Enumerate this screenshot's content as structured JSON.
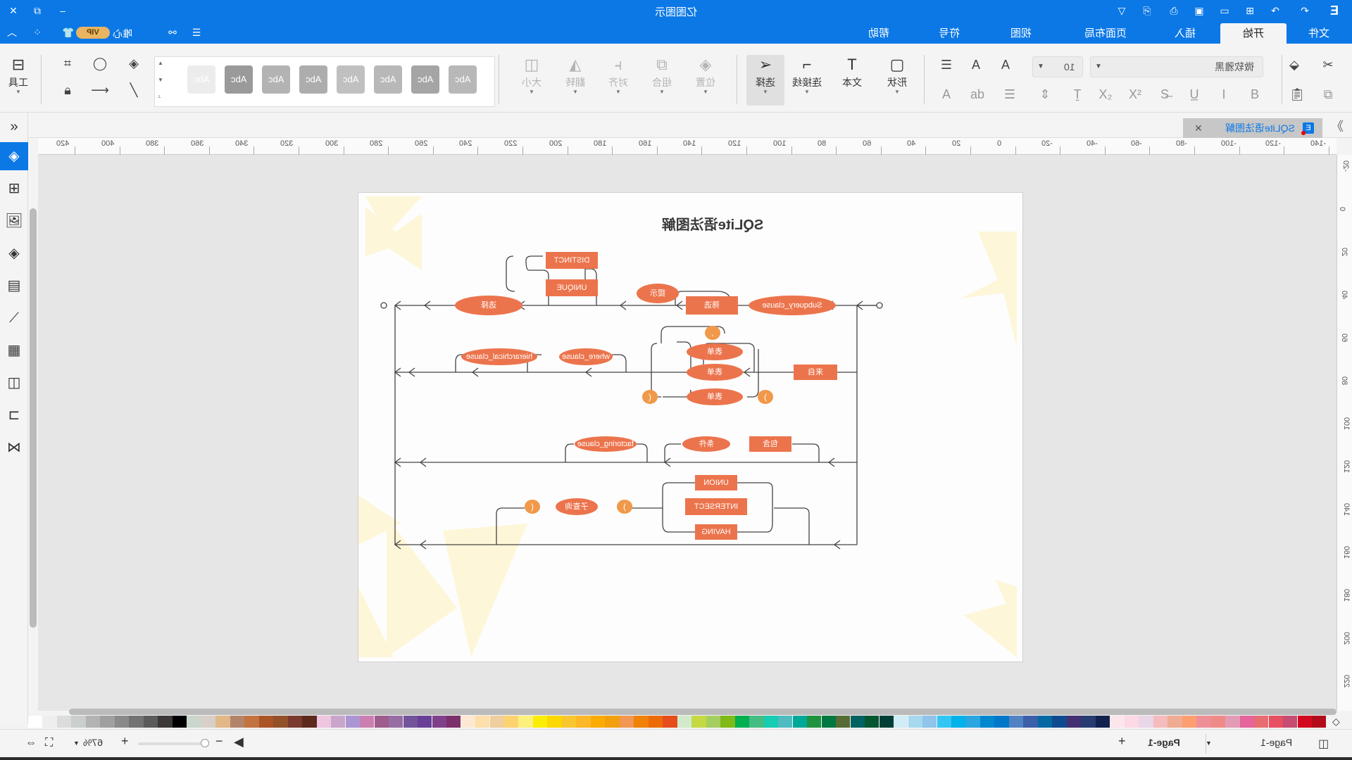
{
  "app": {
    "title": "亿图图示",
    "vip_label": "VIP",
    "user_label": "唯心",
    "window_controls": [
      "close-icon",
      "restore-icon",
      "minimize-icon"
    ],
    "quick_access": [
      "logo-icon",
      "redo-icon",
      "undo-icon",
      "new-icon",
      "open-icon",
      "save-icon",
      "print-icon",
      "export-icon",
      "more-icon"
    ]
  },
  "tabs": [
    {
      "label": "文件",
      "active": false
    },
    {
      "label": "开始",
      "active": true
    },
    {
      "label": "插入",
      "active": false
    },
    {
      "label": "页面布局",
      "active": false
    },
    {
      "label": "视图",
      "active": false
    },
    {
      "label": "符号",
      "active": false
    },
    {
      "label": "帮助",
      "active": false
    }
  ],
  "ribbon": {
    "clipboard": [
      "cut-icon",
      "format-painter-icon",
      "copy-icon",
      "paste-icon"
    ],
    "font_name": "微软雅黑",
    "font_size": "10",
    "font_buttons": [
      "grow-font-icon",
      "shrink-font-icon",
      "align-icon",
      "bold-icon",
      "italic-icon",
      "underline-icon",
      "strikethrough-icon",
      "superscript-icon",
      "subscript-icon",
      "text-format-icon",
      "line-spacing-icon",
      "bullets-icon",
      "highlight-icon",
      "font-color-icon"
    ],
    "tools": [
      {
        "label": "形状",
        "icon": "rectangle-icon",
        "enabled": true
      },
      {
        "label": "文本",
        "icon": "text-icon",
        "enabled": true
      },
      {
        "label": "连接线",
        "icon": "connector-icon",
        "enabled": true
      },
      {
        "label": "选择",
        "icon": "select-arrow-icon",
        "enabled": true,
        "active": true
      },
      {
        "label": "位置",
        "icon": "layers-icon",
        "enabled": false
      },
      {
        "label": "组合",
        "icon": "group-icon",
        "enabled": false
      },
      {
        "label": "对齐",
        "icon": "align-icon",
        "enabled": false
      },
      {
        "label": "翻转",
        "icon": "flip-icon",
        "enabled": false
      },
      {
        "label": "大小",
        "icon": "size-icon",
        "enabled": false
      }
    ],
    "style_swatches": [
      "Abc",
      "Abc",
      "Abc",
      "Abc",
      "Abc",
      "Abc",
      "Abc",
      "Abc"
    ],
    "style_colors": [
      "#ececec",
      "#9a9a9a",
      "#b3b3b3",
      "#adadad",
      "#c0c0c0",
      "#b8b8b8",
      "#a5a5a5",
      "#b8b8b8"
    ],
    "tools_label": "工具"
  },
  "document": {
    "tab_title": "SQLite语法图解",
    "modified": true
  },
  "rulers": {
    "horizontal": [
      "420",
      "400",
      "380",
      "360",
      "340",
      "320",
      "300",
      "280",
      "260",
      "240",
      "220",
      "200",
      "180",
      "160",
      "140",
      "120",
      "100",
      "80",
      "60",
      "40",
      "20",
      "0",
      "-20",
      "-40",
      "-60",
      "-80",
      "-100",
      "-120",
      "-140"
    ],
    "vertical": [
      "-20",
      "0",
      "20",
      "40",
      "60",
      "80",
      "100",
      "120",
      "140",
      "160",
      "180",
      "200",
      "220"
    ]
  },
  "left_panel": [
    "expand-icon",
    "fill-icon",
    "symbols-icon",
    "image-icon",
    "layers-icon",
    "page-icon",
    "chart-icon",
    "table-icon",
    "org-icon",
    "outline-icon",
    "mindmap-icon"
  ],
  "diagram": {
    "title": "SQLite语法图解",
    "rectangles": [
      "DISTINCT",
      "UNIQUE",
      "筛选",
      "来自",
      "包含",
      "UNION",
      "INTERSECT",
      "HAVING"
    ],
    "ellipses": [
      "Subquery_clause",
      "提示",
      "选择",
      "表单",
      "表单",
      "表单",
      "where_clause",
      "hierarchical_clause",
      "条件",
      "factoring_clause",
      "子查询"
    ],
    "circles": [
      ",",
      "(",
      ")",
      "(",
      ")"
    ],
    "colors": {
      "node": "#ec744c",
      "circle": "#f0994a",
      "line": "#444444",
      "decor": "#fdf6d8"
    }
  },
  "palette": [
    "#ffffff",
    "#eeeeee",
    "#dcdcdc",
    "#cbcfcc",
    "#b3b3b3",
    "#a0a0a0",
    "#8a8a8a",
    "#737373",
    "#5b5b5b",
    "#3d3838",
    "#000000",
    "#cbd6cc",
    "#d8d0c8",
    "#e2b888",
    "#b4846a",
    "#c27340",
    "#aa5428",
    "#925129",
    "#7a3b2e",
    "#5c2a1d",
    "#efc6df",
    "#c9a5cb",
    "#a996d2",
    "#cc7fb1",
    "#9f5d8d",
    "#976da4",
    "#73549a",
    "#6a3f96",
    "#80408a",
    "#7d2f6c",
    "#fde9d3",
    "#fedfa9",
    "#efcf9d",
    "#fdd371",
    "#fdf07d",
    "#fbee05",
    "#fcd800",
    "#f9c630",
    "#fdb828",
    "#fcab00",
    "#f2a00e",
    "#f29754",
    "#f08208",
    "#ed6b06",
    "#e64d1c",
    "#d2eacc",
    "#c5d942",
    "#a5ce61",
    "#80ba19",
    "#01af50",
    "#44bd82",
    "#16ccb3",
    "#4ebbc0",
    "#00a997",
    "#1f923f",
    "#007841",
    "#566c34",
    "#016361",
    "#025630",
    "#003f35",
    "#d0ecf6",
    "#a7d9ee",
    "#8fc4eb",
    "#33c6f2",
    "#00b2ea",
    "#2aa6e0",
    "#0088cf",
    "#0077c9",
    "#5182c3",
    "#3c5fa9",
    "#0468a5",
    "#104a8e",
    "#432f72",
    "#263b72",
    "#12224f",
    "#fde5ec",
    "#fcd9e5",
    "#e9d6e6",
    "#f5bcbd",
    "#f0ab93",
    "#fd9e70",
    "#ee8f97",
    "#ef8b86",
    "#e39cb6",
    "#e4649b",
    "#e86d71",
    "#e84f60",
    "#c54d72",
    "#d30a1f",
    "#b30d1b"
  ],
  "status": {
    "page_tab": "Page-1",
    "current_page": "Page-1",
    "zoom": "67%",
    "zoom_level": 0.67
  }
}
